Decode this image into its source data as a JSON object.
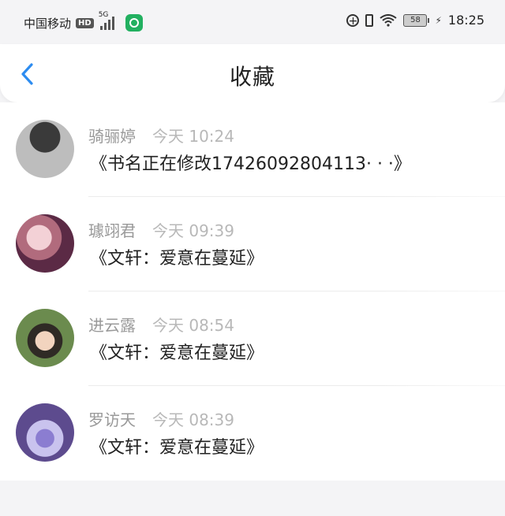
{
  "statusbar": {
    "carrier": "中国移动",
    "hd_badge": "HD",
    "network": "5G",
    "battery": "58",
    "time": "18:25"
  },
  "header": {
    "title": "收藏"
  },
  "items": [
    {
      "name": "骑骊婷",
      "time": "今天 10:24",
      "content": "《书名正在修改17426092804113· · ·》"
    },
    {
      "name": "璩翊君",
      "time": "今天 09:39",
      "content": "《文轩：爱意在蔓延》"
    },
    {
      "name": "进云露",
      "time": "今天 08:54",
      "content": "《文轩：爱意在蔓延》"
    },
    {
      "name": "罗访天",
      "time": "今天 08:39",
      "content": "《文轩：爱意在蔓延》"
    }
  ],
  "colors": {
    "accent_back": "#2d8cf0",
    "background": "#f4f4f6"
  },
  "icons": [
    "circle-plus-icon",
    "vibrate-icon",
    "wifi-icon",
    "battery-icon",
    "back-chevron-icon"
  ]
}
